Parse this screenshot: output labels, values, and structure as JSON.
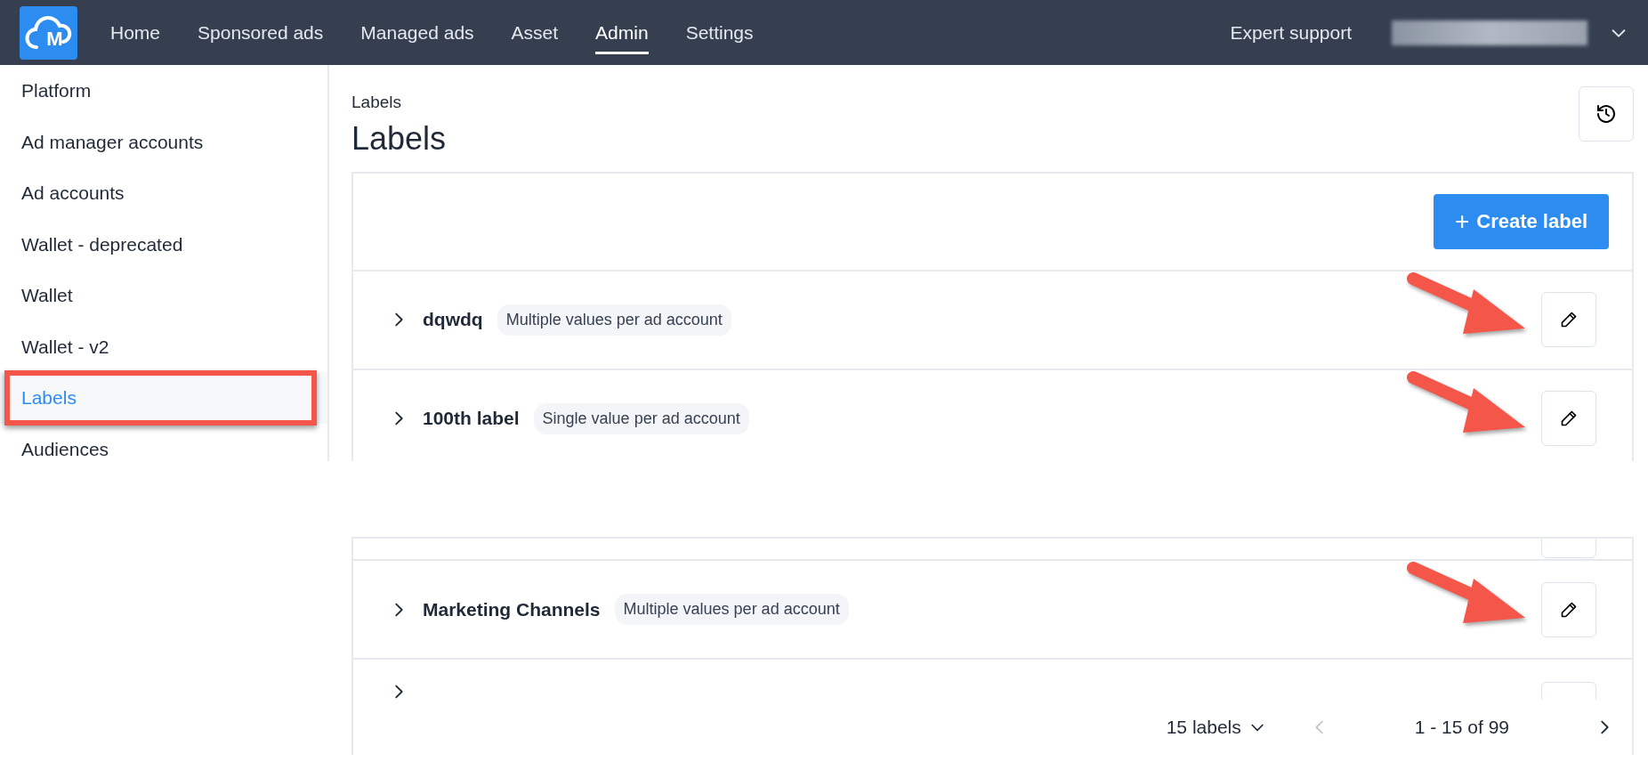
{
  "navbar": {
    "logo_letter": "M",
    "links": [
      {
        "label": "Home",
        "selected": false
      },
      {
        "label": "Sponsored ads",
        "selected": false
      },
      {
        "label": "Managed ads",
        "selected": false
      },
      {
        "label": "Asset",
        "selected": false
      },
      {
        "label": "Admin",
        "selected": true
      },
      {
        "label": "Settings",
        "selected": false
      }
    ],
    "support": "Expert support"
  },
  "sidebar": {
    "items": [
      {
        "label": "Platform",
        "selected": false,
        "highlighted": false
      },
      {
        "label": "Ad manager accounts",
        "selected": false,
        "highlighted": false
      },
      {
        "label": "Ad accounts",
        "selected": false,
        "highlighted": false
      },
      {
        "label": "Wallet - deprecated",
        "selected": false,
        "highlighted": false
      },
      {
        "label": "Wallet",
        "selected": false,
        "highlighted": false
      },
      {
        "label": "Wallet - v2",
        "selected": false,
        "highlighted": false
      },
      {
        "label": "Labels",
        "selected": true,
        "highlighted": true
      },
      {
        "label": "Audiences",
        "selected": false,
        "highlighted": false
      }
    ]
  },
  "breadcrumb": "Labels",
  "title": "Labels",
  "create_button": {
    "icon": "+",
    "label": "Create label"
  },
  "rows_top": [
    {
      "name": "dqwdq",
      "tag": "Multiple values per ad account",
      "annotated": true
    },
    {
      "name": "100th label",
      "tag": "Single value per ad account",
      "annotated": true
    }
  ],
  "rows_bottom": [
    {
      "name": "Marketing Channels",
      "tag": "Multiple values per ad account",
      "annotated": true
    }
  ],
  "footer": {
    "page_size": "15 labels",
    "range": "1 - 15 of 99"
  }
}
